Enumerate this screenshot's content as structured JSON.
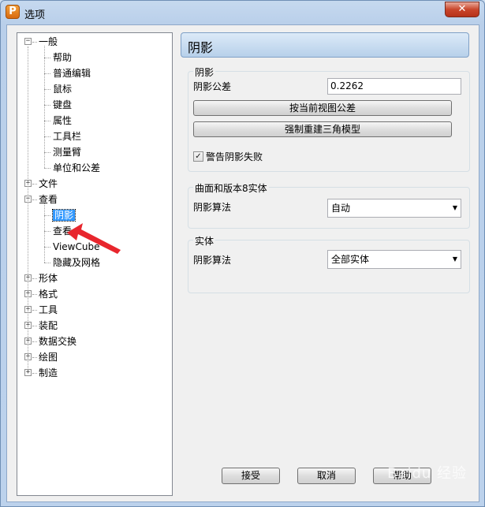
{
  "window": {
    "title": "选项",
    "app_icon_letter": "P",
    "close_glyph": "✕"
  },
  "tree": {
    "items": [
      {
        "label": "一般",
        "level": 0,
        "toggle": "−"
      },
      {
        "label": "帮助",
        "level": 1
      },
      {
        "label": "普通编辑",
        "level": 1
      },
      {
        "label": "鼠标",
        "level": 1
      },
      {
        "label": "键盘",
        "level": 1
      },
      {
        "label": "属性",
        "level": 1
      },
      {
        "label": "工具栏",
        "level": 1
      },
      {
        "label": "测量臂",
        "level": 1
      },
      {
        "label": "单位和公差",
        "level": 1
      },
      {
        "label": "文件",
        "level": 0,
        "toggle": "+"
      },
      {
        "label": "查看",
        "level": 0,
        "toggle": "−"
      },
      {
        "label": "阴影",
        "level": 1,
        "selected": true
      },
      {
        "label": "查看",
        "level": 1
      },
      {
        "label": "ViewCube",
        "level": 1
      },
      {
        "label": "隐藏及网格",
        "level": 1
      },
      {
        "label": "形体",
        "level": 0,
        "toggle": "+"
      },
      {
        "label": "格式",
        "level": 0,
        "toggle": "+"
      },
      {
        "label": "工具",
        "level": 0,
        "toggle": "+"
      },
      {
        "label": "装配",
        "level": 0,
        "toggle": "+"
      },
      {
        "label": "数据交换",
        "level": 0,
        "toggle": "+"
      },
      {
        "label": "绘图",
        "level": 0,
        "toggle": "+"
      },
      {
        "label": "制造",
        "level": 0,
        "toggle": "+"
      }
    ]
  },
  "panel": {
    "header": "阴影",
    "shade_group": {
      "title": "阴影",
      "tolerance_label": "阴影公差",
      "tolerance_value": "0.2262",
      "match_view_button": "按当前视图公差",
      "rebuild_button": "强制重建三角模型",
      "warn_checkbox_label": "警告阴影失败",
      "warn_checked": true
    },
    "surface_group": {
      "title": "曲面和版本8实体",
      "algorithm_label": "阴影算法",
      "algorithm_value": "自动"
    },
    "solid_group": {
      "title": "实体",
      "algorithm_label": "阴影算法",
      "algorithm_value": "全部实体"
    }
  },
  "footer": {
    "accept": "接受",
    "cancel": "取消",
    "help": "帮助"
  },
  "watermark": "Baidu 经验",
  "colors": {
    "selection": "#3399ff",
    "annotation_arrow": "#e8262d"
  }
}
